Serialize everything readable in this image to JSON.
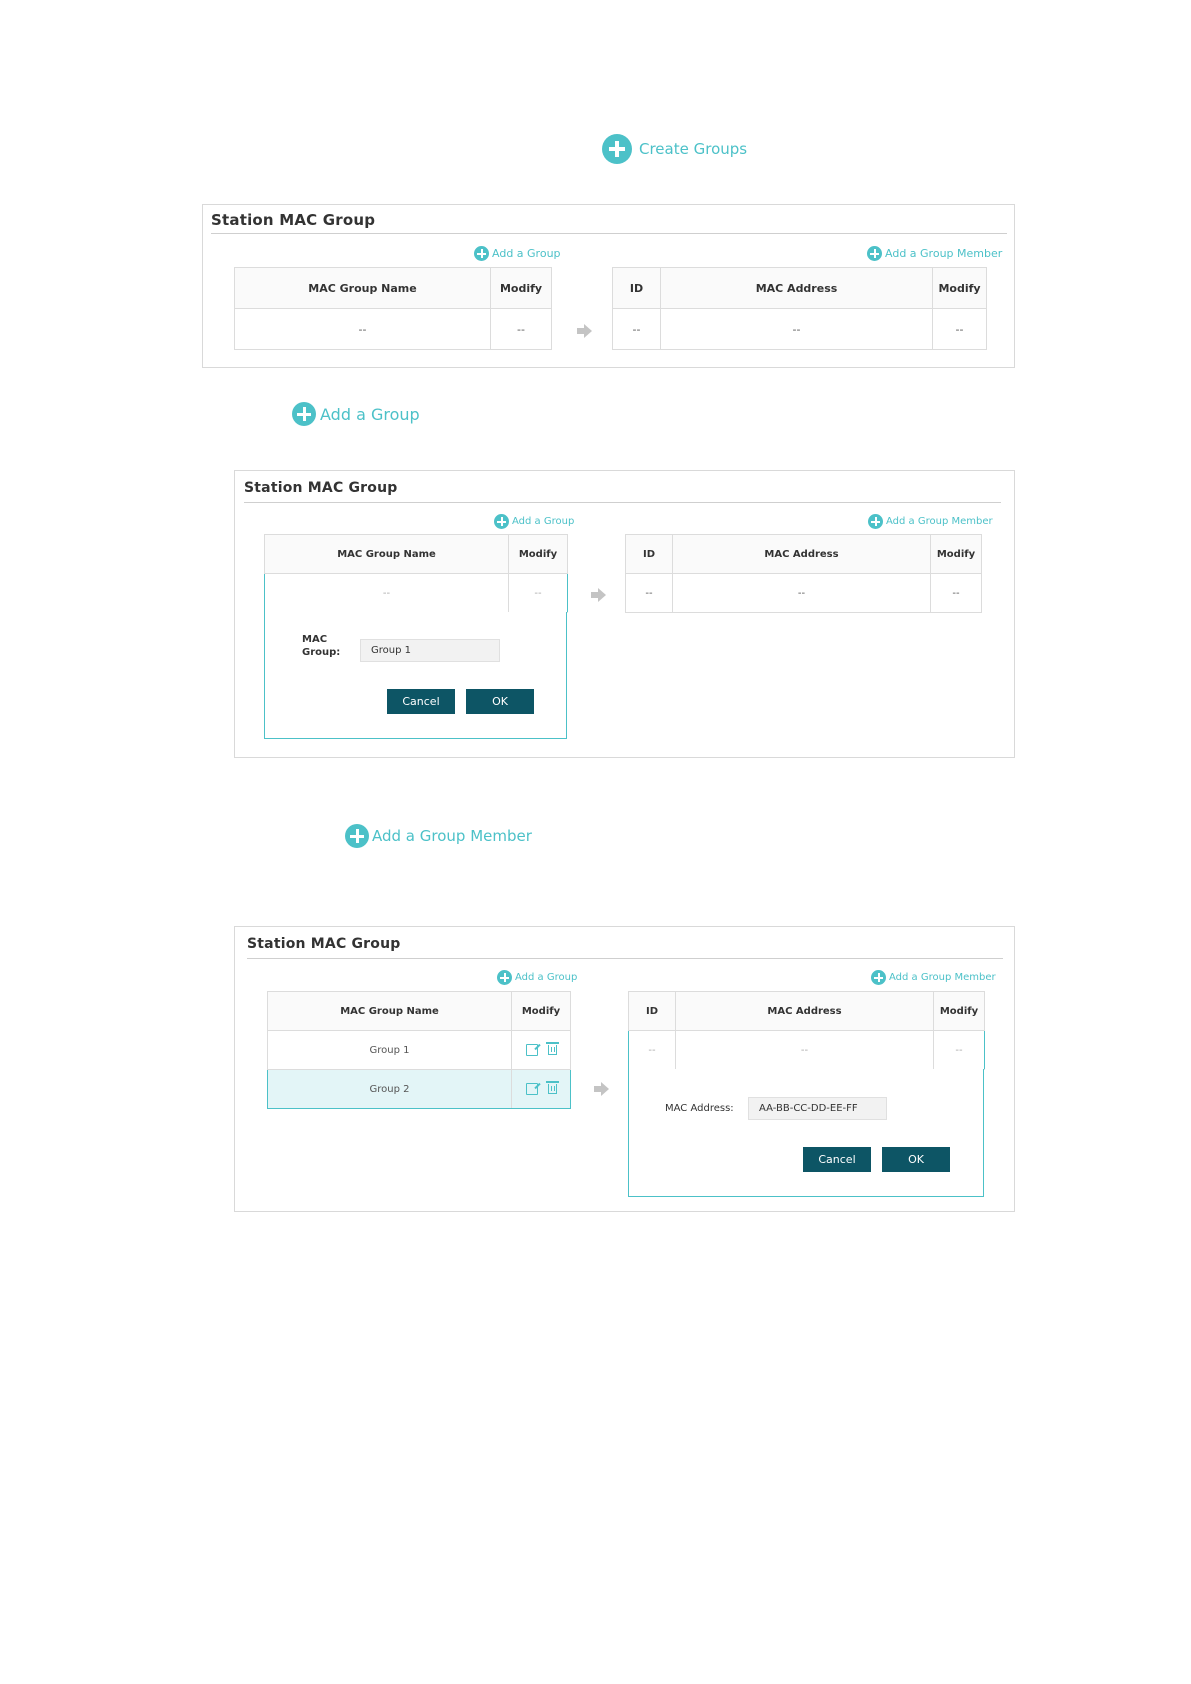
{
  "section1": {
    "link_label": "Create Groups",
    "panel": {
      "title": "Station MAC Group",
      "add_group": "Add a Group",
      "add_member": "Add a Group Member",
      "group_table": {
        "col_name": "MAC Group Name",
        "col_modify": "Modify",
        "row_name": "--",
        "row_modify": "--"
      },
      "member_table": {
        "col_id": "ID",
        "col_mac": "MAC Address",
        "col_modify": "Modify",
        "row_id": "--",
        "row_mac": "--",
        "row_modify": "--"
      }
    }
  },
  "section2": {
    "link_label": "Add a Group",
    "panel": {
      "title": "Station MAC Group",
      "add_group": "Add a Group",
      "add_member": "Add a Group Member",
      "group_table": {
        "col_name": "MAC Group Name",
        "col_modify": "Modify",
        "row_name": "--",
        "row_modify": "--"
      },
      "member_table": {
        "col_id": "ID",
        "col_mac": "MAC Address",
        "col_modify": "Modify",
        "row_id": "--",
        "row_mac": "--",
        "row_modify": "--"
      },
      "form": {
        "label_line1": "MAC",
        "label_line2": "Group:",
        "value": "Group 1",
        "cancel": "Cancel",
        "ok": "OK"
      }
    }
  },
  "section3": {
    "link_label": "Add a Group Member",
    "panel": {
      "title": "Station MAC Group",
      "add_group": "Add a Group",
      "add_member": "Add a Group Member",
      "group_table": {
        "col_name": "MAC Group Name",
        "col_modify": "Modify",
        "rows": [
          "Group 1",
          "Group 2"
        ]
      },
      "member_table": {
        "col_id": "ID",
        "col_mac": "MAC Address",
        "col_modify": "Modify",
        "row_id": "--",
        "row_mac": "--",
        "row_modify": "--"
      },
      "form": {
        "label": "MAC Address:",
        "value": "AA-BB-CC-DD-EE-FF",
        "cancel": "Cancel",
        "ok": "OK"
      }
    }
  },
  "colors": {
    "accent": "#4cc1c8",
    "button": "#0d5565",
    "selected_row": "#e3f5f7"
  },
  "icons": [
    "plus-circle-icon",
    "arrow-right-icon",
    "edit-icon",
    "trash-icon"
  ]
}
